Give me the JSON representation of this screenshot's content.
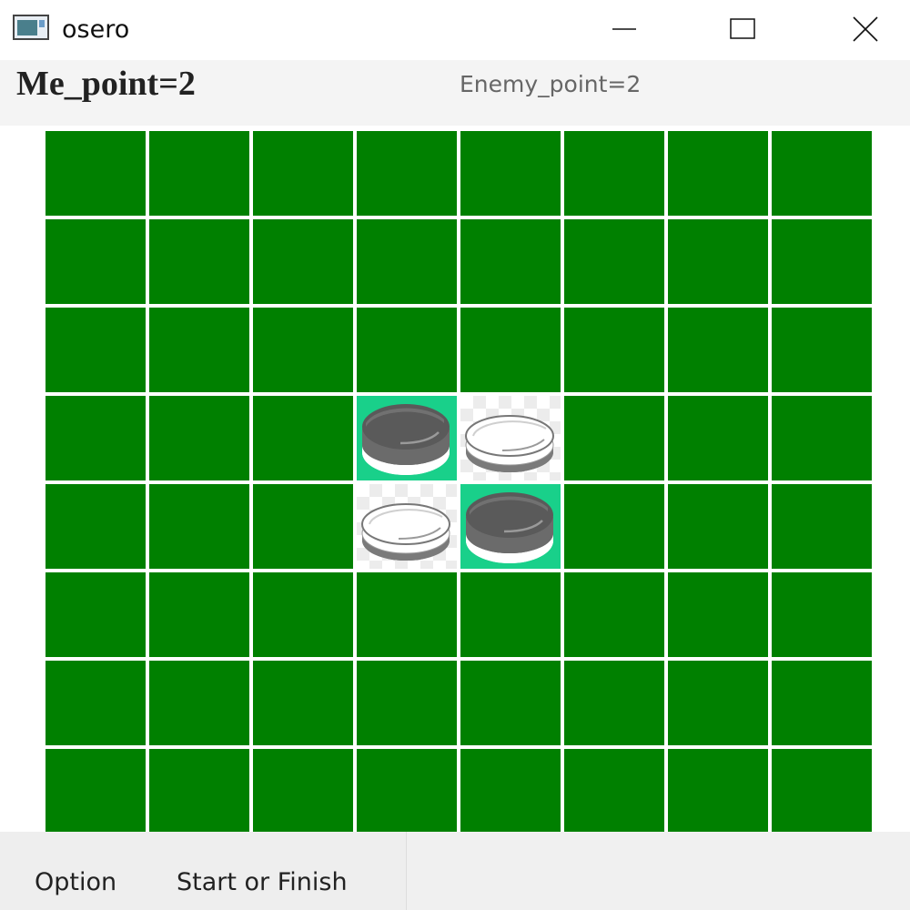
{
  "window": {
    "title": "osero",
    "icon": "app-window-icon",
    "controls": [
      "minimize-icon",
      "maximize-icon",
      "close-icon"
    ]
  },
  "score": {
    "me": "Me_point=2",
    "enemy": "Enemy_point=2"
  },
  "board": {
    "rows": 8,
    "cols": 8,
    "colors": {
      "empty_cell": "#008000",
      "black_highlight": "#19d08a",
      "grid_line": "#ffffff"
    },
    "pieces": [
      {
        "row": 3,
        "col": 3,
        "color": "black"
      },
      {
        "row": 3,
        "col": 4,
        "color": "white"
      },
      {
        "row": 4,
        "col": 3,
        "color": "white"
      },
      {
        "row": 4,
        "col": 4,
        "color": "black"
      }
    ]
  },
  "menu": {
    "option": "Option",
    "start_finish": "Start or Finish"
  }
}
